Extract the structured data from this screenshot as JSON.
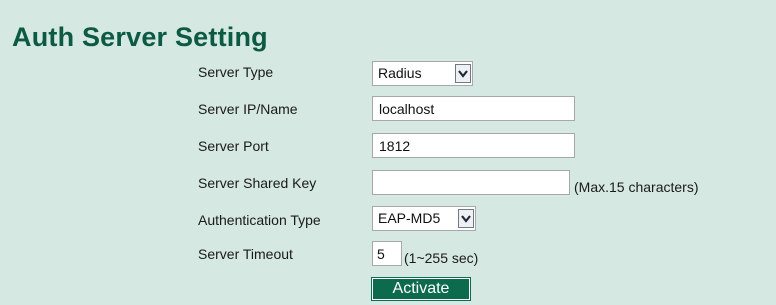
{
  "page": {
    "title": "Auth Server Setting"
  },
  "form": {
    "server_type": {
      "label": "Server Type",
      "value": "Radius"
    },
    "server_ip": {
      "label": "Server IP/Name",
      "value": "localhost"
    },
    "server_port": {
      "label": "Server Port",
      "value": "1812"
    },
    "shared_key": {
      "label": "Server Shared Key",
      "value": "",
      "note": "(Max.15 characters)"
    },
    "auth_type": {
      "label": "Authentication Type",
      "value": "EAP-MD5"
    },
    "timeout": {
      "label": "Server Timeout",
      "value": "5",
      "note": "(1~255 sec)"
    }
  },
  "actions": {
    "activate_label": "Activate"
  },
  "icons": {
    "dropdown": "chevron-down-icon"
  }
}
